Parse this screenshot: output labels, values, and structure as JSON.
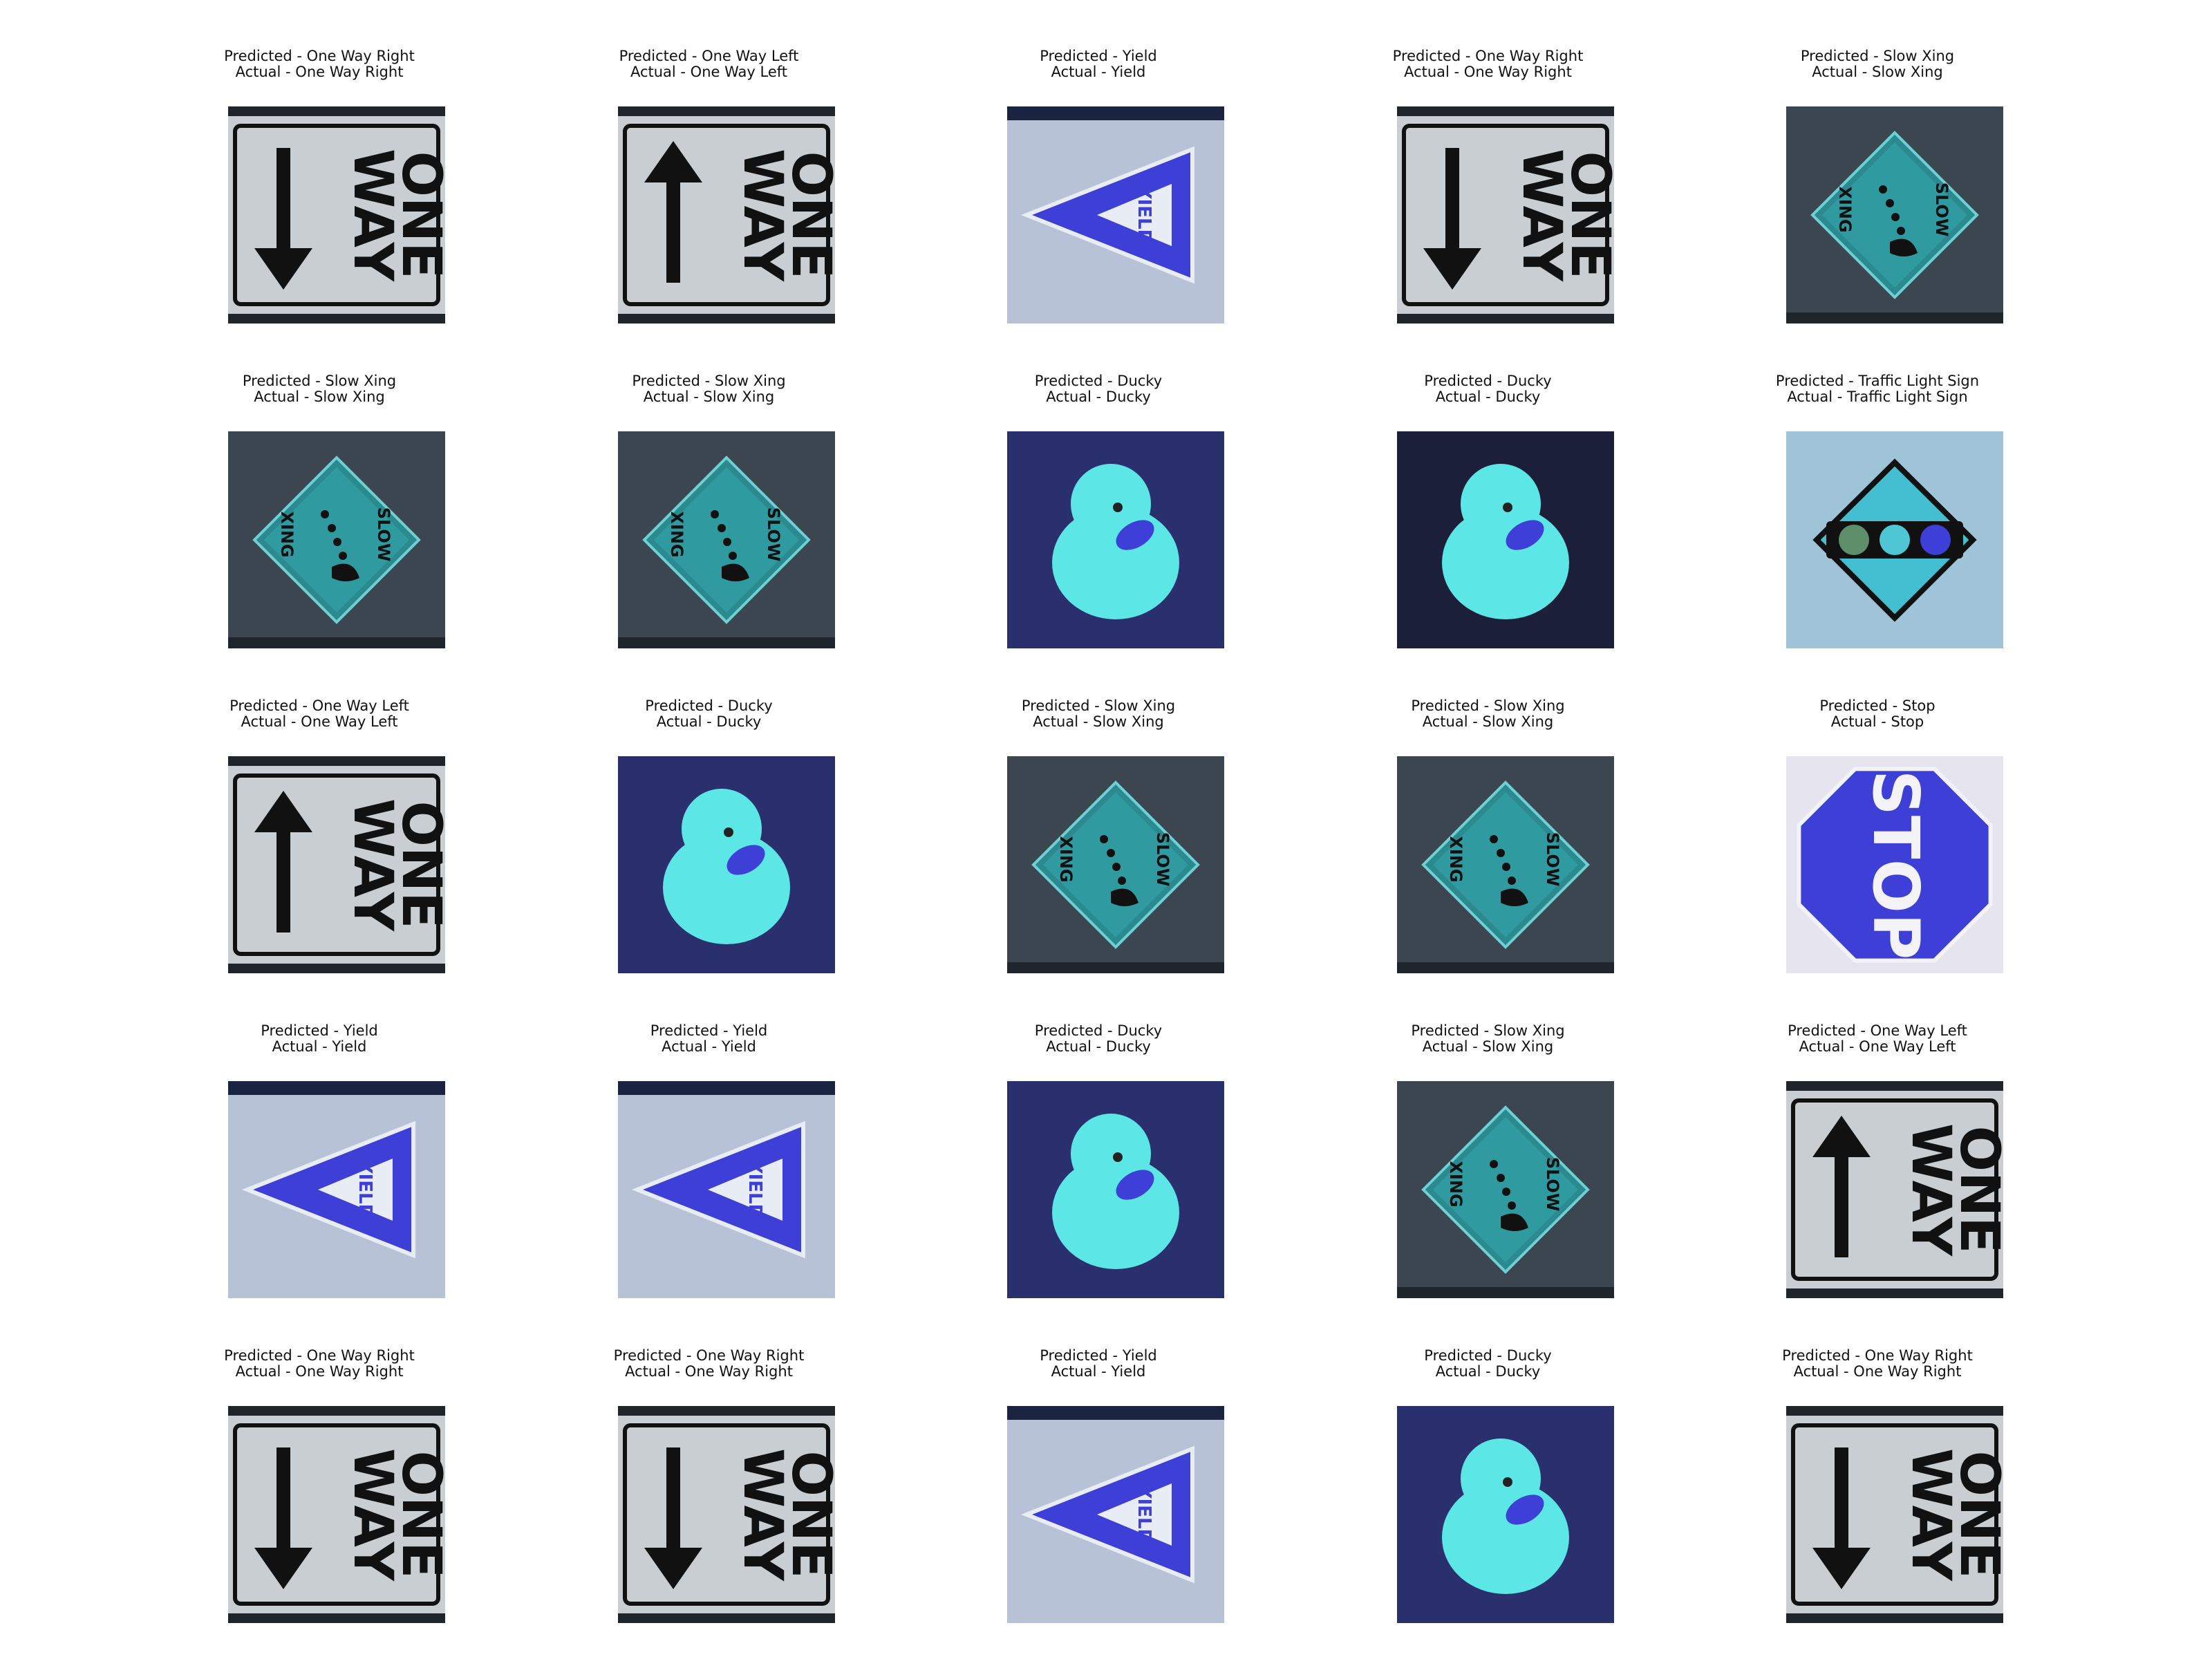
{
  "figure": {
    "panels": [
      {
        "predicted": "Predicted - One Way Right",
        "actual": "Actual - One Way Right",
        "class": "one-way-right"
      },
      {
        "predicted": "Predicted - One Way Left",
        "actual": "Actual - One Way Left",
        "class": "one-way-left"
      },
      {
        "predicted": "Predicted - Yield",
        "actual": "Actual - Yield",
        "class": "yield"
      },
      {
        "predicted": "Predicted - One Way Right",
        "actual": "Actual - One Way Right",
        "class": "one-way-right"
      },
      {
        "predicted": "Predicted - Slow Xing",
        "actual": "Actual - Slow Xing",
        "class": "slow-xing"
      },
      {
        "predicted": "Predicted - Slow Xing",
        "actual": "Actual - Slow Xing",
        "class": "slow-xing"
      },
      {
        "predicted": "Predicted - Slow Xing",
        "actual": "Actual - Slow Xing",
        "class": "slow-xing"
      },
      {
        "predicted": "Predicted - Ducky",
        "actual": "Actual - Ducky",
        "class": "ducky"
      },
      {
        "predicted": "Predicted - Ducky",
        "actual": "Actual - Ducky",
        "class": "ducky"
      },
      {
        "predicted": "Predicted - Traffic Light Sign",
        "actual": "Actual - Traffic Light Sign",
        "class": "traffic-light"
      },
      {
        "predicted": "Predicted - One Way Left",
        "actual": "Actual - One Way Left",
        "class": "one-way-left"
      },
      {
        "predicted": "Predicted - Ducky",
        "actual": "Actual - Ducky",
        "class": "ducky"
      },
      {
        "predicted": "Predicted - Slow Xing",
        "actual": "Actual - Slow Xing",
        "class": "slow-xing"
      },
      {
        "predicted": "Predicted - Slow Xing",
        "actual": "Actual - Slow Xing",
        "class": "slow-xing"
      },
      {
        "predicted": "Predicted - Stop",
        "actual": "Actual - Stop",
        "class": "stop"
      },
      {
        "predicted": "Predicted - Yield",
        "actual": "Actual - Yield",
        "class": "yield"
      },
      {
        "predicted": "Predicted - Yield",
        "actual": "Actual - Yield",
        "class": "yield"
      },
      {
        "predicted": "Predicted - Ducky",
        "actual": "Actual - Ducky",
        "class": "ducky"
      },
      {
        "predicted": "Predicted - Slow Xing",
        "actual": "Actual - Slow Xing",
        "class": "slow-xing"
      },
      {
        "predicted": "Predicted - One Way Left",
        "actual": "Actual - One Way Left",
        "class": "one-way-left"
      },
      {
        "predicted": "Predicted - One Way Right",
        "actual": "Actual - One Way Right",
        "class": "one-way-right"
      },
      {
        "predicted": "Predicted - One Way Right",
        "actual": "Actual - One Way Right",
        "class": "one-way-right"
      },
      {
        "predicted": "Predicted - Yield",
        "actual": "Actual - Yield",
        "class": "yield"
      },
      {
        "predicted": "Predicted - Ducky",
        "actual": "Actual - Ducky",
        "class": "ducky"
      },
      {
        "predicted": "Predicted - One Way Right",
        "actual": "Actual - One Way Right",
        "class": "one-way-right"
      }
    ],
    "sign_text": {
      "one_way_1": "ONE",
      "one_way_2": "WAY",
      "yield": "YIELD",
      "slow": "SLOW",
      "xing": "XING",
      "stop": "STOP"
    },
    "colors": {
      "sign_blue": "#3d3fd6",
      "ducky_cyan": "#5ce6e6",
      "dark_bg": "#1a1f2e"
    }
  }
}
